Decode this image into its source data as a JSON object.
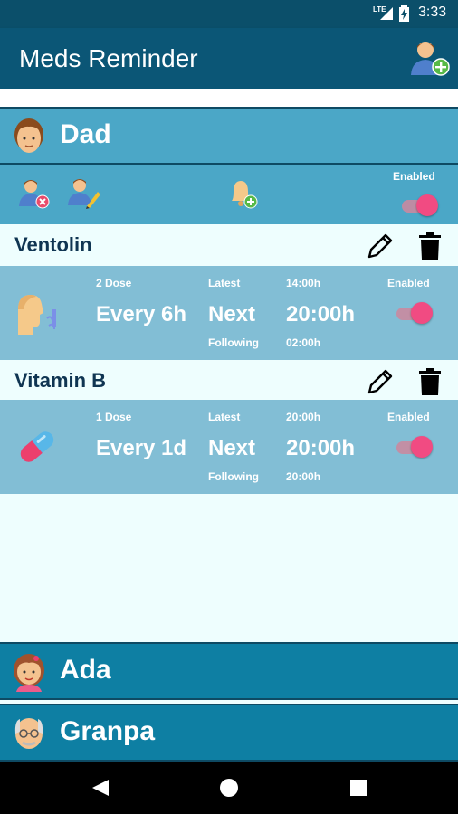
{
  "status_bar": {
    "network": "LTE",
    "time": "3:33"
  },
  "app_bar": {
    "title": "Meds Reminder",
    "add_person_icon": "add-person-icon"
  },
  "persons": [
    {
      "name": "Dad",
      "expanded": true,
      "toolbar": {
        "enabled_label": "Enabled",
        "enabled": true
      },
      "medications": [
        {
          "name": "Ventolin",
          "icon": "inhaler-icon",
          "dose_label": "2 Dose",
          "frequency": "Every 6h",
          "latest_label": "Latest",
          "latest_time": "14:00h",
          "next_label": "Next",
          "next_time": "20:00h",
          "following_label": "Following",
          "following_time": "02:00h",
          "enabled_label": "Enabled",
          "enabled": true
        },
        {
          "name": "Vitamin B",
          "icon": "pill-icon",
          "dose_label": "1 Dose",
          "frequency": "Every 1d",
          "latest_label": "Latest",
          "latest_time": "20:00h",
          "next_label": "Next",
          "next_time": "20:00h",
          "following_label": "Following",
          "following_time": "20:00h",
          "enabled_label": "Enabled",
          "enabled": true
        }
      ]
    },
    {
      "name": "Ada",
      "expanded": false
    },
    {
      "name": "Granpa",
      "expanded": false
    }
  ],
  "colors": {
    "app_bar": "#0b5676",
    "expanded_header": "#4ba7c7",
    "collapsed_header": "#0e7fa3",
    "med_card": "#82bed5",
    "toggle": "#f14b82"
  }
}
